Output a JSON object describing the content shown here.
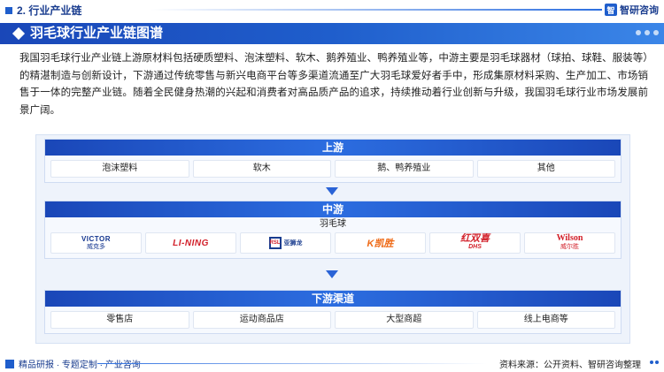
{
  "header": {
    "section_title": "2. 行业产业链",
    "brand": "智研咨询",
    "brand_mark": "智"
  },
  "banner": {
    "title": "羽毛球行业产业链图谱"
  },
  "description": "我国羽毛球行业产业链上游原材料包括硬质塑料、泡沫塑料、软木、鹅养殖业、鸭养殖业等，中游主要是羽毛球器材（球拍、球鞋、服装等）的精湛制造与创新设计，下游通过传统零售与新兴电商平台等多渠道流通至广大羽毛球爱好者手中，形成集原材料采购、生产加工、市场销售于一体的完整产业链。随着全民健身热潮的兴起和消费者对高品质产品的追求，持续推动着行业创新与升级，我国羽毛球行业市场发展前景广阔。",
  "upstream": {
    "title": "上游",
    "items": [
      "泡沫塑料",
      "软木",
      "鹅、鸭养殖业",
      "其他"
    ]
  },
  "midstream": {
    "title": "中游",
    "product": "羽毛球",
    "brands": {
      "victor_wordmark": "VICTOR",
      "victor_cn": "威克多",
      "lining": "LI-NING",
      "rsl_mark": "RSL",
      "rsl_cn": "亚狮龙",
      "kason": "K凯胜",
      "dhs_cn": "红双喜",
      "dhs_en": "DHS",
      "wilson_wordmark": "Wilson",
      "wilson_cn": "威尔胜"
    }
  },
  "downstream": {
    "title": "下游渠道",
    "items": [
      "零售店",
      "运动商品店",
      "大型商超",
      "线上电商等"
    ]
  },
  "footer": {
    "left": "精品研报 · 专题定制 · 产业咨询",
    "source": "资料来源：公开资料、智研咨询整理"
  },
  "colors": {
    "primary": "#1f5ecc",
    "dark_blue": "#1a3d8f",
    "panel_bg": "#eef3fb"
  }
}
